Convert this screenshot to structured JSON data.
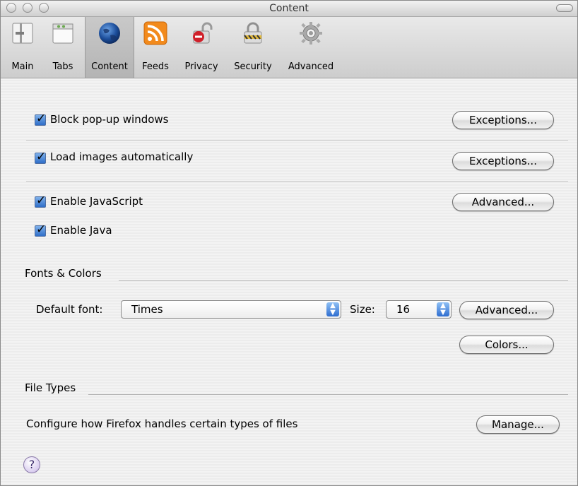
{
  "window": {
    "title": "Content"
  },
  "toolbar": {
    "items": [
      {
        "label": "Main",
        "icon": "main-icon"
      },
      {
        "label": "Tabs",
        "icon": "tabs-icon"
      },
      {
        "label": "Content",
        "icon": "globe-icon",
        "selected": true
      },
      {
        "label": "Feeds",
        "icon": "rss-icon"
      },
      {
        "label": "Privacy",
        "icon": "padlock-open-icon"
      },
      {
        "label": "Security",
        "icon": "padlock-closed-icon"
      },
      {
        "label": "Advanced",
        "icon": "gear-icon"
      }
    ]
  },
  "content": {
    "popups": {
      "label": "Block pop-up windows",
      "checked": true,
      "button": "Exceptions..."
    },
    "images": {
      "label": "Load images automatically",
      "checked": true,
      "button": "Exceptions..."
    },
    "javascript": {
      "label": "Enable JavaScript",
      "checked": true,
      "button": "Advanced..."
    },
    "java": {
      "label": "Enable Java",
      "checked": true
    }
  },
  "fonts": {
    "section_title": "Fonts & Colors",
    "default_font_label": "Default font:",
    "default_font_value": "Times",
    "size_label": "Size:",
    "size_value": "16",
    "advanced_button": "Advanced...",
    "colors_button": "Colors..."
  },
  "filetypes": {
    "section_title": "File Types",
    "description": "Configure how Firefox handles certain types of files",
    "manage_button": "Manage..."
  },
  "help": {
    "glyph": "?"
  },
  "colors": {
    "accent": "#2f6ec8",
    "help": "#d9cdef"
  }
}
